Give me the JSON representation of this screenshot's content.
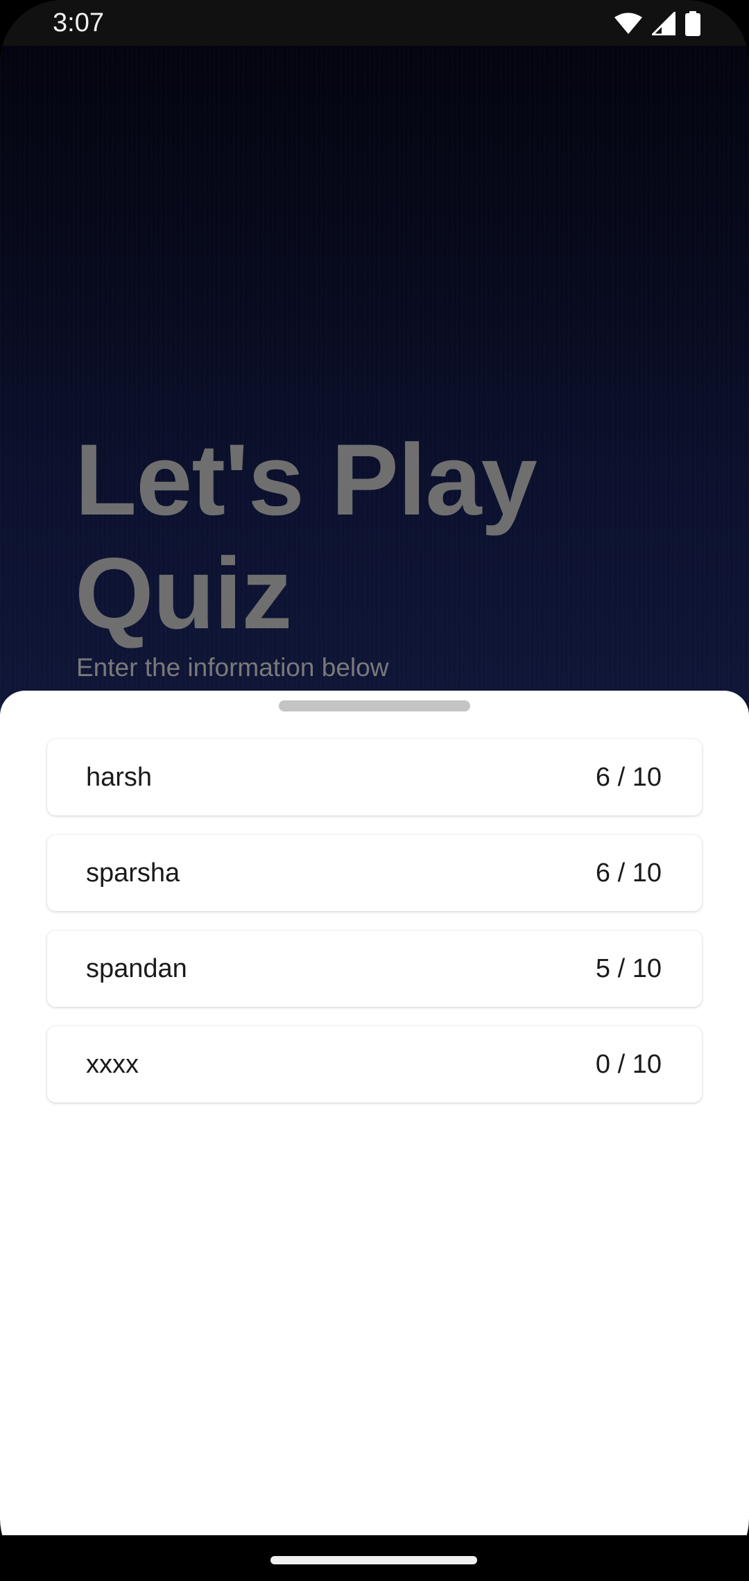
{
  "status_bar": {
    "time": "3:07",
    "icons": [
      "wifi-icon",
      "cellular-signal-icon",
      "battery-icon"
    ]
  },
  "hero": {
    "title": "Let's Play Quiz",
    "subtitle": "Enter the information below"
  },
  "scores": [
    {
      "name": "harsh",
      "score": "6 / 10"
    },
    {
      "name": "sparsha",
      "score": "6 / 10"
    },
    {
      "name": "spandan",
      "score": "5 / 10"
    },
    {
      "name": "xxxx",
      "score": "0 / 10"
    }
  ],
  "colors": {
    "background_top": "#03040f",
    "background_bottom": "#101638",
    "hero_text": "#6f6f6f",
    "sheet": "#ffffff",
    "handle": "#c4c4c4"
  }
}
